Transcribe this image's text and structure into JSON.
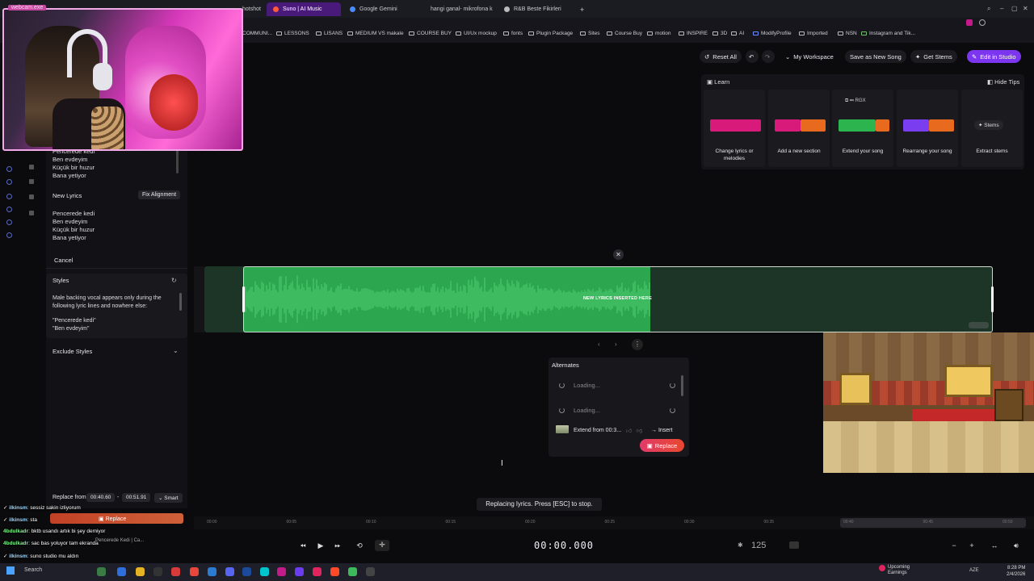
{
  "browser": {
    "tabs": [
      {
        "label": "hotshot",
        "color": "#888"
      },
      {
        "label": "Suno | AI Music",
        "color": "#ff5a3c",
        "active": true
      },
      {
        "label": "Google Gemini",
        "color": "#4a8cff"
      },
      {
        "label": "hangi ganal- mikrofona k",
        "color": "#ff2d2d"
      },
      {
        "label": "R&B Beste Fikirleri",
        "color": "#bbb"
      }
    ],
    "new_tab": "+",
    "bookmarks": [
      "COMMUNI...",
      "LESSONS",
      "LISANS",
      "MEDIUM VS makale",
      "COURSE BUY",
      "UI/Ux mockup",
      "fonts",
      "Plugin Package",
      "Sites",
      "Course Buy",
      "motion",
      "INSPIRE",
      "3D",
      "AI",
      "ModifyProfile",
      "Imported",
      "NSN",
      "Instagram and Tik..."
    ]
  },
  "webcam": {
    "label": "webcam.exe"
  },
  "left_panel": {
    "old_lyrics": [
      "Pencerede kedi",
      "Ben evdeyim",
      "Küçük bir huzur",
      "Bana yetiyor"
    ],
    "new_lyrics_label": "New Lyrics",
    "fix_alignment": "Fix Alignment",
    "new_lyrics": [
      "Pencerede kedi",
      "Ben evdeyim",
      "Küçük bir huzur",
      "Bana yetiyor"
    ],
    "cancel": "Cancel",
    "styles_label": "Styles",
    "styles_text_1": "Male backing vocal appears only during the",
    "styles_text_2": "following lyric lines and nowhere else:",
    "styles_quote_1": "\"Pencerede kedi\"",
    "styles_quote_2": "\"Ben evdeyim\"",
    "exclude_styles": "Exclude Styles",
    "replace_from_label": "Replace from",
    "replace_from": "00:40.60",
    "replace_sep": "-",
    "replace_to": "00:51.91",
    "smart": "Smart"
  },
  "toolbar": {
    "reset_all": "Reset All",
    "workspace": "My Workspace",
    "save_new": "Save as New Song",
    "get_stems": "Get Stems",
    "edit_studio": "Edit in Studio"
  },
  "learn": {
    "title": "Learn",
    "hide_tips": "Hide Tips",
    "cards": [
      {
        "caption": "Change lyrics or melodies"
      },
      {
        "caption": "Add a new section"
      },
      {
        "caption": "Extend your song"
      },
      {
        "caption": "Rearrange your song"
      },
      {
        "caption": "Extract stems",
        "button": "Stems"
      }
    ],
    "colors": {
      "magenta": "#d81b7a",
      "orange": "#e86a1e",
      "green": "#2cb54f",
      "purple": "#7a3df0"
    }
  },
  "waveform": {
    "inserted_label": "NEW LYRICS INSERTED HERE",
    "fill_color": "#2ca74f"
  },
  "alternates": {
    "title": "Alternates",
    "rows": [
      {
        "label": "Loading..."
      },
      {
        "label": "Loading..."
      }
    ],
    "extend_label": "Extend from 00:3...",
    "insert": "Insert",
    "replace": "Replace"
  },
  "toast": "Replacing lyrics. Press [ESC] to stop.",
  "timeline": {
    "ticks": [
      "00:00",
      "00:05",
      "00:10",
      "00:15",
      "00:20",
      "00:25",
      "00:30",
      "00:35",
      "00:40",
      "00:45",
      "00:50"
    ]
  },
  "transport": {
    "time": "00:00.000",
    "bpm": "125"
  },
  "chat": [
    {
      "user": "ilkinsm",
      "msg": "sessiz sakin izliyorum"
    },
    {
      "user": "ilkinsm",
      "msg": "sta"
    },
    {
      "user": "4bdulkadr",
      "msg": "bktb usandı artık bi şey demiyor"
    },
    {
      "user": "4bdulkadr",
      "msg": "sac bas yoluyor tam ekranda"
    },
    {
      "user": "ilkinsm",
      "msg": "suno studio mu aldın"
    },
    {
      "user": "ilkinsm",
      "msg": "cus"
    }
  ],
  "chat_overlay": {
    "replace": "Replace",
    "now_playing": "Pencerede Kedi | Ca..."
  },
  "taskbar": {
    "search": "Search",
    "weather_title": "Upcoming",
    "weather_sub": "Earnings",
    "lang": "AZE",
    "time": "8:28 PM",
    "date": "2/4/2026"
  }
}
